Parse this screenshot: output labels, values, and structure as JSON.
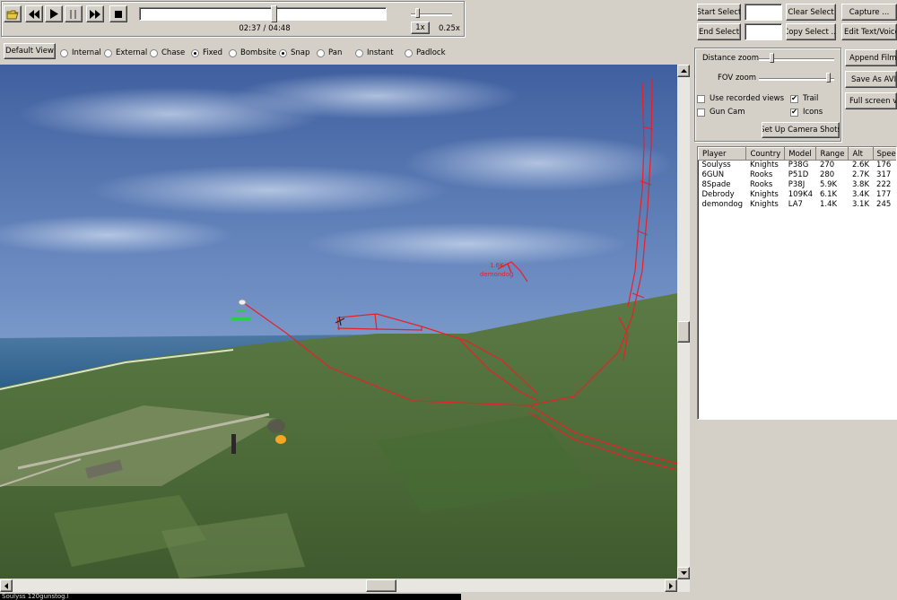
{
  "playback": {
    "time_readout": "02:37 / 04:48",
    "progress_fraction": 0.545,
    "speed_multiplier": "1x",
    "speed_value": "0.25x",
    "speed_fraction": 0.1
  },
  "views": {
    "default_view_label": "Default View",
    "options": [
      {
        "label": "Internal",
        "selected": false
      },
      {
        "label": "External",
        "selected": false
      },
      {
        "label": "Chase",
        "selected": false
      },
      {
        "label": "Fixed",
        "selected": true
      },
      {
        "label": "Bombsite",
        "selected": false
      },
      {
        "label": "Snap",
        "selected": true
      },
      {
        "label": "Pan",
        "selected": false
      },
      {
        "label": "Instant",
        "selected": false
      },
      {
        "label": "Padlock",
        "selected": false
      }
    ]
  },
  "selection": {
    "start_select": "Start Select",
    "end_select": "End Select",
    "clear_select": "Clear Select",
    "copy_select": "Copy Select ...",
    "start_value": "",
    "end_value": ""
  },
  "capture": {
    "capture": "Capture ...",
    "edit_text_voice": "Edit Text/Voice...",
    "append_films": "Append Films...",
    "save_as_avi": "Save As AVI...",
    "full_screen_view": "Full screen view"
  },
  "camera": {
    "distance_zoom": "Distance zoom",
    "fov_zoom": "FOV zoom",
    "distance_fraction": 0.14,
    "fov_fraction": 0.95,
    "use_recorded_views": "Use recorded views",
    "use_recorded_views_checked": false,
    "trail": "Trail",
    "trail_checked": true,
    "gun_cam": "Gun Cam",
    "gun_cam_checked": false,
    "icons": "Icons",
    "icons_checked": true,
    "setup_camera_shots": "Set Up Camera Shots"
  },
  "players_table": {
    "columns": [
      "Player",
      "Country",
      "Model",
      "Range",
      "Alt",
      "Speed"
    ],
    "rows": [
      [
        "Soulyss",
        "Knights",
        "P38G",
        "270",
        "2.6K",
        "176"
      ],
      [
        "6GUN",
        "Rooks",
        "P51D",
        "280",
        "2.7K",
        "317"
      ],
      [
        "8Spade",
        "Rooks",
        "P38J",
        "5.9K",
        "3.8K",
        "222"
      ],
      [
        "Debrody",
        "Knights",
        "109K4",
        "6.1K",
        "3.4K",
        "177"
      ],
      [
        "demondog",
        "Knights",
        "LA7",
        "1.4K",
        "3.1K",
        "245"
      ]
    ]
  },
  "viewport": {
    "enemy_label_alt": "1.6K",
    "enemy_label_name": "demondog",
    "friendly_label_alt": "",
    "friendly_label_name": "",
    "status_text": "Soulyss 120gunstog.l"
  },
  "colors": {
    "trail": "#e8202a",
    "enemy_label": "#e8202a",
    "friendly_label": "#2ecc40",
    "window_bg": "#d4d0c8"
  }
}
